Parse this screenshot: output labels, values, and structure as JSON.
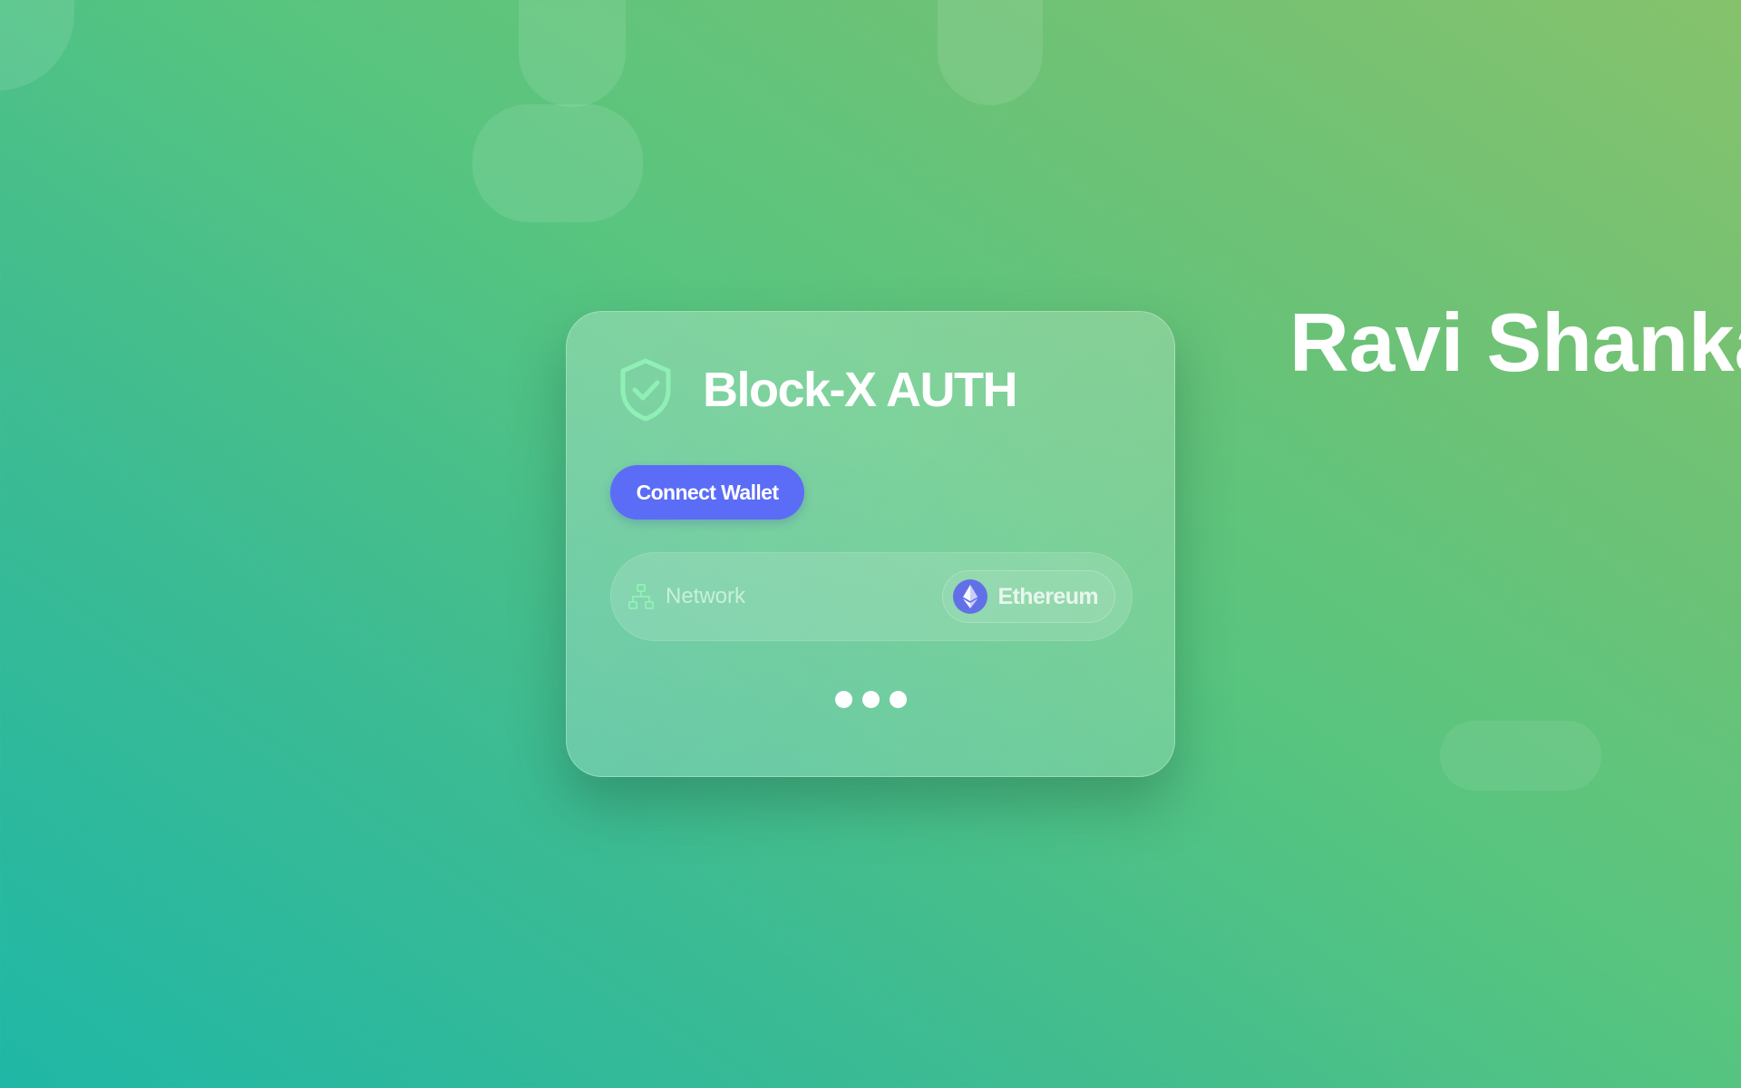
{
  "app": {
    "title": "Block-X AUTH"
  },
  "wallet": {
    "connect_label": "Connect Wallet"
  },
  "network": {
    "label": "Network",
    "selected": "Ethereum"
  },
  "side_name": "Ravi Shanka",
  "icons": {
    "header": "shield-check-icon",
    "network": "network-tree-icon",
    "chain": "ethereum-icon"
  },
  "colors": {
    "accent": "#5b6cf7",
    "icon_green": "#8ff0b5",
    "background_start": "#1fb7a6",
    "background_end": "#86c26c"
  }
}
